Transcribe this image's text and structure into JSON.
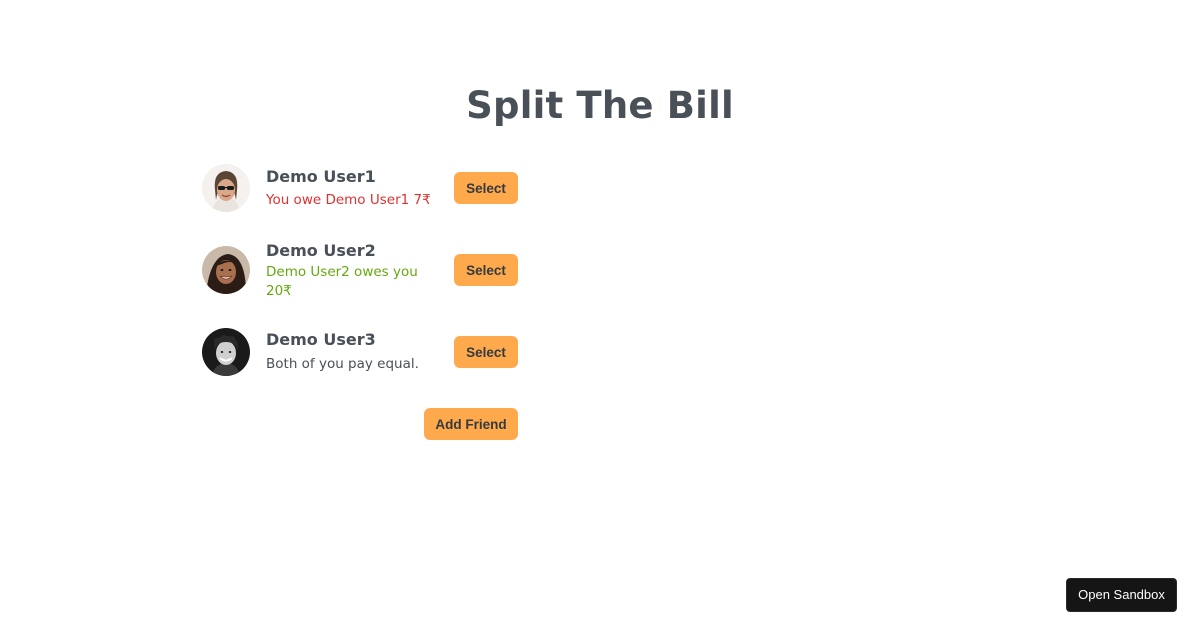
{
  "header": {
    "title": "Split The Bill"
  },
  "friends": [
    {
      "name": "Demo User1",
      "status": "You owe Demo User1 7₹",
      "status_type": "owe",
      "select_label": "Select",
      "avatar_icon": "avatar-man-sunglasses"
    },
    {
      "name": "Demo User2",
      "status": "Demo User2 owes you 20₹",
      "status_type": "owed",
      "select_label": "Select",
      "avatar_icon": "avatar-woman-smiling"
    },
    {
      "name": "Demo User3",
      "status": "Both of you pay equal.",
      "status_type": "even",
      "select_label": "Select",
      "avatar_icon": "avatar-man-curly-hair"
    }
  ],
  "actions": {
    "add_friend_label": "Add Friend"
  },
  "sandbox": {
    "label": "Open Sandbox"
  },
  "colors": {
    "accent": "#ffa94d",
    "owe": "#e03131",
    "owed": "#66a80f",
    "text": "#495057"
  }
}
